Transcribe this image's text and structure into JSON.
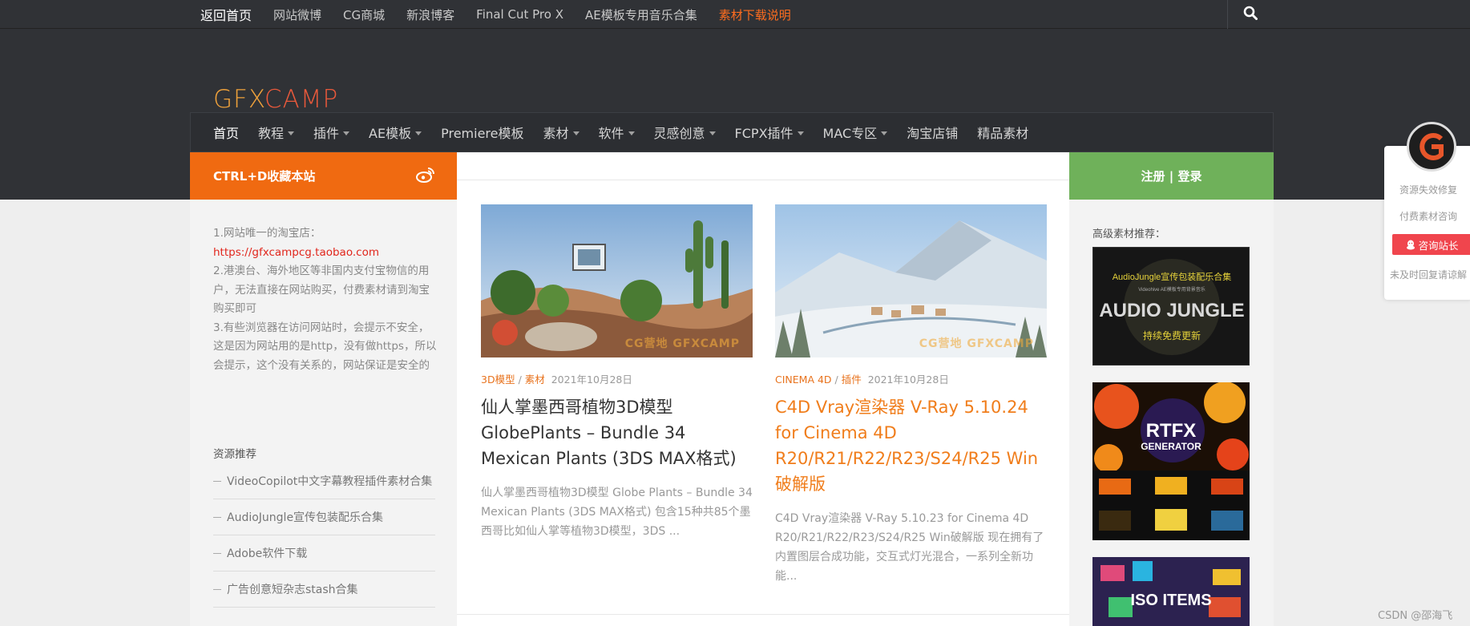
{
  "topbar": {
    "links": [
      "返回首页",
      "网站微博",
      "CG商城",
      "新浪博客",
      "Final Cut Pro X",
      "AE模板专用音乐合集",
      "素材下载说明"
    ]
  },
  "logo": {
    "part1": "GFX",
    "part2": "CAMP"
  },
  "nav": {
    "items": [
      {
        "label": "首页",
        "caret": false
      },
      {
        "label": "教程",
        "caret": true
      },
      {
        "label": "插件",
        "caret": true
      },
      {
        "label": "AE模板",
        "caret": true
      },
      {
        "label": "Premiere模板",
        "caret": false
      },
      {
        "label": "素材",
        "caret": true
      },
      {
        "label": "软件",
        "caret": true
      },
      {
        "label": "灵感创意",
        "caret": true
      },
      {
        "label": "FCPX插件",
        "caret": true
      },
      {
        "label": "MAC专区",
        "caret": true
      },
      {
        "label": "淘宝店铺",
        "caret": false
      },
      {
        "label": "精品素材",
        "caret": false
      }
    ]
  },
  "left": {
    "bookmark": "CTRL+D收藏本站",
    "notice": {
      "line1": "1.网站唯一的淘宝店：",
      "link": "https://gfxcampcg.taobao.com",
      "line2": "2.港澳台、海外地区等非国内支付宝物信的用户，无法直接在网站购买，付费素材请到淘宝购买即可",
      "line3": "3.有些浏览器在访问网站时，会提示不安全，这是因为网站用的是http，没有做https，所以会提示，这个没有关系的，网站保证是安全的"
    },
    "res_title": "资源推荐",
    "res_items": [
      "VideoCopilot中文字幕教程插件素材合集",
      "AudioJungle宣传包装配乐合集",
      "Adobe软件下载",
      "广告创意短杂志stash合集"
    ]
  },
  "posts": [
    {
      "cat1": "3D模型",
      "cat2": "素材",
      "date": "2021年10月28日",
      "title": "仙人掌墨西哥植物3D模型 GlobePlants – Bundle 34 Mexican Plants (3DS MAX格式)",
      "excerpt": "仙人掌墨西哥植物3D模型 Globe Plants – Bundle 34 Mexican Plants (3DS MAX格式) 包含15种共85个墨西哥比如仙人掌等植物3D模型，3DS ...",
      "watermark": "CG营地 GFXCAMP"
    },
    {
      "cat1": "CINEMA 4D",
      "cat2": "插件",
      "date": "2021年10月28日",
      "title": "C4D Vray渲染器 V-Ray 5.10.24 for Cinema 4D R20/R21/R22/R23/S24/R25 Win破解版",
      "excerpt": "C4D Vray渲染器 V-Ray 5.10.23 for Cinema 4D R20/R21/R22/R23/S24/R25 Win破解版 现在拥有了内置图层合成功能，交互式灯光混合，一系列全新功能...",
      "watermark": "CG营地 GFXCAMP"
    }
  ],
  "right": {
    "login": "注册 | 登录",
    "rec_title": "高级素材推荐：",
    "ad1": {
      "top": "AudioJungle宣传包装配乐合集",
      "sub": "Videohive AE模板专用背景音乐",
      "big": "AUDIO JUNGLE",
      "bottom": "持续免费更新"
    },
    "ad2": {
      "big": "RTFX",
      "sub": "GENERATOR"
    },
    "ad3": {
      "big": "ISO ITEMS"
    }
  },
  "widget": {
    "line1": "资源失效修复",
    "line2": "付费素材咨询",
    "button": "咨询站长",
    "line3": "未及时回复请谅解"
  },
  "footer_mark": "CSDN @邵海飞",
  "colors": {
    "orange": "#f06a11",
    "green": "#6fb15a",
    "dark": "#303236",
    "link_red": "#e1261c"
  }
}
